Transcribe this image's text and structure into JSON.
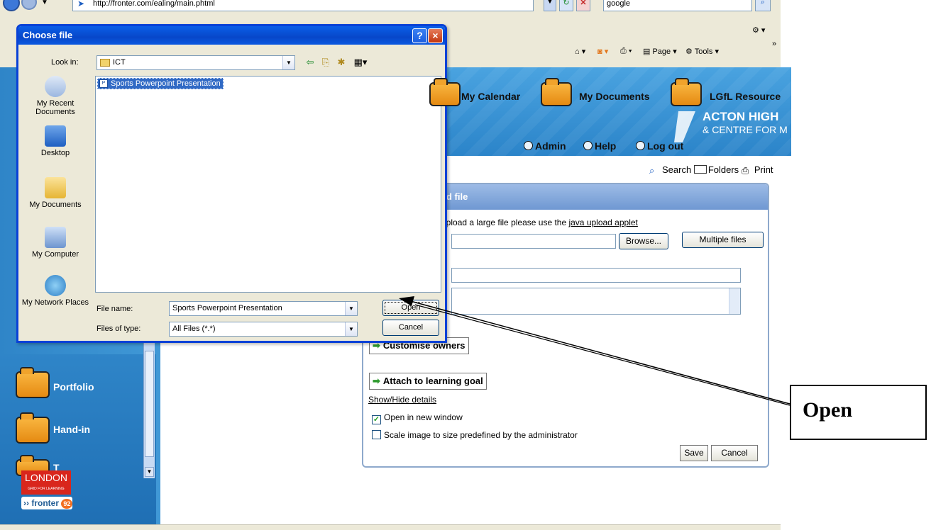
{
  "browser": {
    "address": "http://fronter.com/ealing/main.phtml",
    "search_value": "google",
    "toolbar": {
      "page_label": "Page",
      "tools_label": "Tools",
      "chevron": "»"
    }
  },
  "banner": {
    "my_calendar": "My Calendar",
    "my_documents": "My Documents",
    "lgfl": "LGfL Resource",
    "school_line1": "ACTON HIGH",
    "school_line2": "& CENTRE FOR M",
    "admin": "Admin",
    "help": "Help",
    "logout": "Log out"
  },
  "utility": {
    "search": "Search",
    "folders": "Folders",
    "print": "Print"
  },
  "upload_panel": {
    "title_visible": "d file",
    "java_prefix": "upload a large file please use the ",
    "java_link": "java upload applet",
    "browse_label": "Browse...",
    "multiple_label": "Multiple files",
    "customise_owners": "Customise owners",
    "attach_goal": "Attach to learning goal",
    "show_hide": "Show/Hide details",
    "open_new_window": "Open in new window",
    "open_new_window_checked": true,
    "scale_image": "Scale image to size predefined by the administrator",
    "scale_image_checked": false,
    "save_label": "Save",
    "cancel_label": "Cancel"
  },
  "sidebar": {
    "portfolio": "Portfolio",
    "handin": "Hand-in",
    "partial_item": "T",
    "london_logo": "LONDON",
    "london_sub": "GRID FOR LEARNING",
    "fronter_logo": "fronter",
    "fronter_num": "92"
  },
  "dialog": {
    "title": "Choose file",
    "help_glyph": "?",
    "close_glyph": "×",
    "look_in_label": "Look in:",
    "look_in_value": "ICT",
    "places": [
      "My Recent Documents",
      "Desktop",
      "My Documents",
      "My Computer",
      "My Network Places"
    ],
    "files": [
      "Sports Powerpoint Presentation"
    ],
    "file_name_label": "File name:",
    "file_name_value": "Sports Powerpoint Presentation",
    "files_of_type_label": "Files of type:",
    "files_of_type_value": "All Files (*.*)",
    "open_label": "Open",
    "cancel_label": "Cancel"
  },
  "annotation": {
    "text": "Open"
  },
  "colors": {
    "xp_title_blue": "#0a5fe8",
    "selection_blue": "#316ac5",
    "fronter_blue": "#2b84c9",
    "folder_orange": "#f0a32c"
  }
}
